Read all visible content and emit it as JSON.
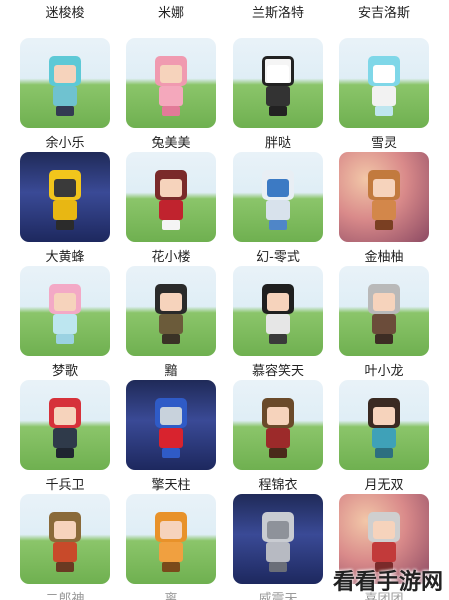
{
  "rows": [
    [
      "迷梭梭",
      "米娜",
      "兰斯洛特",
      "安吉洛斯"
    ],
    [
      "余小乐",
      "兔美美",
      "胖哒",
      "雪灵"
    ],
    [
      "大黄蜂",
      "花小楼",
      "幻-零式",
      "金柚柚"
    ],
    [
      "梦歌",
      "黯",
      "慕容笑天",
      "叶小龙"
    ],
    [
      "千兵卫",
      "擎天柱",
      "程锦衣",
      "月无双"
    ],
    [
      "二郎神",
      "离",
      "威震天",
      "喜团团"
    ]
  ],
  "watermark": "看看手游网"
}
